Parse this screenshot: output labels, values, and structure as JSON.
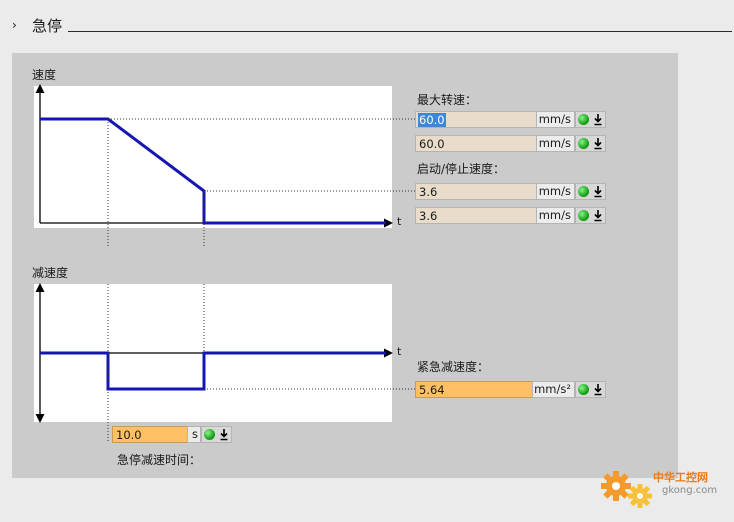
{
  "section": {
    "arrow": "›",
    "title": "急停"
  },
  "velocity_chart": {
    "label": "速度",
    "axis_t": "t"
  },
  "decel_chart": {
    "label": "减速度",
    "axis_t": "t"
  },
  "max_speed": {
    "label": "最大转速：",
    "value_1": "60.0",
    "unit_1": "mm/s",
    "value_2": "60.0",
    "unit_2": "mm/s"
  },
  "start_stop_speed": {
    "label": "启动/停止速度：",
    "value_1": "3.6",
    "unit_1": "mm/s",
    "value_2": "3.6",
    "unit_2": "mm/s"
  },
  "emergency_decel": {
    "label": "紧急减速度：",
    "value": "5.64",
    "unit": "mm/s²"
  },
  "emergency_stop_time": {
    "label": "急停减速时间：",
    "value": "10.0",
    "unit": "s"
  },
  "watermark": {
    "text": "中华工控网",
    "url": "gkong.com"
  },
  "colors": {
    "curve": "#1515b4",
    "field": "#e9dccb",
    "field_active": "#ffc065",
    "selection": "#3d87d8",
    "led": "#16a616"
  }
}
